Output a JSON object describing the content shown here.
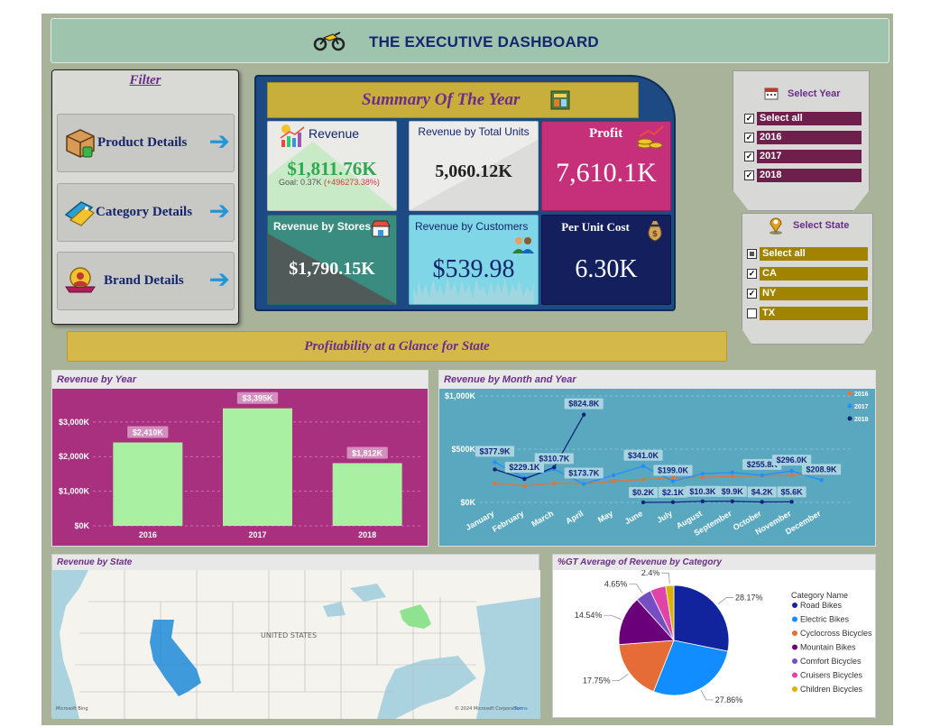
{
  "header": {
    "title": "THE EXECUTIVE DASHBOARD"
  },
  "filter": {
    "title": "Filter",
    "buttons": [
      {
        "label": "Product Details",
        "icon": "product-box-icon"
      },
      {
        "label": "Category Details",
        "icon": "category-tag-icon"
      },
      {
        "label": "Brand Details",
        "icon": "brand-badge-icon"
      }
    ]
  },
  "summary": {
    "title": "Summary Of The Year",
    "cards": {
      "revenue": {
        "title": "Revenue",
        "value": "$1,811.76K",
        "goal": "Goal: 0.37K",
        "delta": "(+496273.38%)"
      },
      "units": {
        "title": "Revenue by Total Units",
        "value": "5,060.12K"
      },
      "profit": {
        "title": "Profit",
        "value": "7,610.1K"
      },
      "stores": {
        "title": "Revenue by Stores",
        "value": "$1,790.15K"
      },
      "customers": {
        "title": "Revenue by Customers",
        "value": "$539.98"
      },
      "unit_cost": {
        "title": "Per Unit Cost",
        "value": "6.30K"
      }
    }
  },
  "year_slicer": {
    "title": "Select Year",
    "items": [
      {
        "label": "Select all",
        "checked": true
      },
      {
        "label": "2016",
        "checked": true
      },
      {
        "label": "2017",
        "checked": true
      },
      {
        "label": "2018",
        "checked": true
      }
    ]
  },
  "state_slicer": {
    "title": "Select State",
    "items": [
      {
        "label": "Select all",
        "checked": "partial"
      },
      {
        "label": "CA",
        "checked": true
      },
      {
        "label": "NY",
        "checked": true
      },
      {
        "label": "TX",
        "checked": false
      }
    ]
  },
  "section_banner": "Profitability at a Glance for State",
  "map": {
    "title": "Revenue by State",
    "country_label": "UNITED STATES",
    "credit": "© 2024 Microsoft Corporation",
    "terms": "Terms",
    "bing": "Microsoft Bing"
  },
  "colors": {
    "magenta_panel": "#a8307f",
    "teal_panel": "#5aa8bf",
    "bar_fill": "#a9f0a3",
    "series_2016": "#e67236",
    "series_2017": "#1e90ff",
    "series_2018": "#14237a"
  },
  "chart_data": [
    {
      "type": "bar",
      "title": "Revenue by Year",
      "categories": [
        "2016",
        "2017",
        "2018"
      ],
      "values": [
        2410,
        3395,
        1812
      ],
      "data_labels": [
        "$2,410K",
        "$3,395K",
        "$1,812K"
      ],
      "ytick_labels": [
        "$0K",
        "$1,000K",
        "$2,000K",
        "$3,000K"
      ],
      "yticks": [
        0,
        1000,
        2000,
        3000
      ],
      "ylim": [
        0,
        3700
      ]
    },
    {
      "type": "line",
      "title": "Revenue by Month and Year",
      "categories": [
        "January",
        "February",
        "March",
        "April",
        "May",
        "June",
        "July",
        "August",
        "September",
        "October",
        "November",
        "December"
      ],
      "ytick_labels": [
        "$0K",
        "$500K",
        "$1,000K"
      ],
      "yticks": [
        0,
        500,
        1000
      ],
      "ylim": [
        0,
        1000
      ],
      "legend": "top-right",
      "series": [
        {
          "name": "2016",
          "values": [
            180,
            155,
            180,
            175,
            200,
            215,
            230,
            235,
            245,
            250,
            255,
            270
          ]
        },
        {
          "name": "2017",
          "values": [
            377.9,
            229.1,
            310.7,
            173.7,
            255,
            341,
            199,
            270,
            280,
            255.8,
            296,
            208.9
          ]
        },
        {
          "name": "2018",
          "values": [
            310,
            220,
            330,
            824.8,
            null,
            0.2,
            2.1,
            10.3,
            9.9,
            4.2,
            5.6,
            null
          ]
        }
      ],
      "data_labels": [
        {
          "series": "2017",
          "index": 0,
          "text": "$377.9K"
        },
        {
          "series": "2017",
          "index": 1,
          "text": "$229.1K"
        },
        {
          "series": "2017",
          "index": 2,
          "text": "$310.7K"
        },
        {
          "series": "2018",
          "index": 3,
          "text": "$824.8K"
        },
        {
          "series": "2017",
          "index": 3,
          "text": "$173.7K"
        },
        {
          "series": "2017",
          "index": 5,
          "text": "$341.0K"
        },
        {
          "series": "2017",
          "index": 6,
          "text": "$199.0K"
        },
        {
          "series": "2017",
          "index": 9,
          "text": "$255.8K"
        },
        {
          "series": "2017",
          "index": 10,
          "text": "$296.0K"
        },
        {
          "series": "2017",
          "index": 11,
          "text": "$208.9K"
        },
        {
          "series": "2018",
          "index": 5,
          "text": "$0.2K"
        },
        {
          "series": "2018",
          "index": 6,
          "text": "$2.1K"
        },
        {
          "series": "2018",
          "index": 7,
          "text": "$10.3K"
        },
        {
          "series": "2018",
          "index": 8,
          "text": "$9.9K"
        },
        {
          "series": "2018",
          "index": 9,
          "text": "$4.2K"
        },
        {
          "series": "2018",
          "index": 10,
          "text": "$5.6K"
        }
      ]
    },
    {
      "type": "pie",
      "title": "%GT Average of Revenue by Category",
      "legend_title": "Category Name",
      "legend": "right",
      "slices": [
        {
          "label": "Road Bikes",
          "value": 28.17,
          "text": "28.17%",
          "color": "#12239e"
        },
        {
          "label": "Electric Bikes",
          "value": 27.86,
          "text": "27.86%",
          "color": "#118dff"
        },
        {
          "label": "Cyclocross Bicycles",
          "value": 17.75,
          "text": "17.75%",
          "color": "#e66c37"
        },
        {
          "label": "Mountain Bikes",
          "value": 14.54,
          "text": "14.54%",
          "color": "#6b007b"
        },
        {
          "label": "Comfort Bicycles",
          "value": 4.65,
          "text": "4.65%",
          "color": "#744ec2"
        },
        {
          "label": "Cruisers Bicycles",
          "value": 4.63,
          "text": "",
          "color": "#e044a7"
        },
        {
          "label": "Children Bicycles",
          "value": 2.4,
          "text": "2.4%",
          "color": "#d9b300"
        }
      ]
    }
  ]
}
